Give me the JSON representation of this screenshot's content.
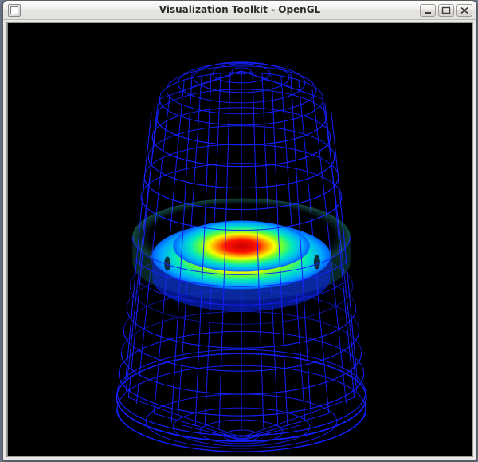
{
  "window": {
    "title": "Visualization Toolkit - OpenGL"
  },
  "buttons": {
    "minimize": "Minimize",
    "maximize": "Maximize",
    "close": "Close"
  },
  "viewport": {
    "background": "#000000",
    "wireframe_color": "#0018ff",
    "colormap_name": "rainbow",
    "colormap_stops": [
      "#0018ff",
      "#00a8ff",
      "#00e8c0",
      "#62ff38",
      "#f8ff00",
      "#ff9600",
      "#ff1200",
      "#c80000"
    ]
  }
}
